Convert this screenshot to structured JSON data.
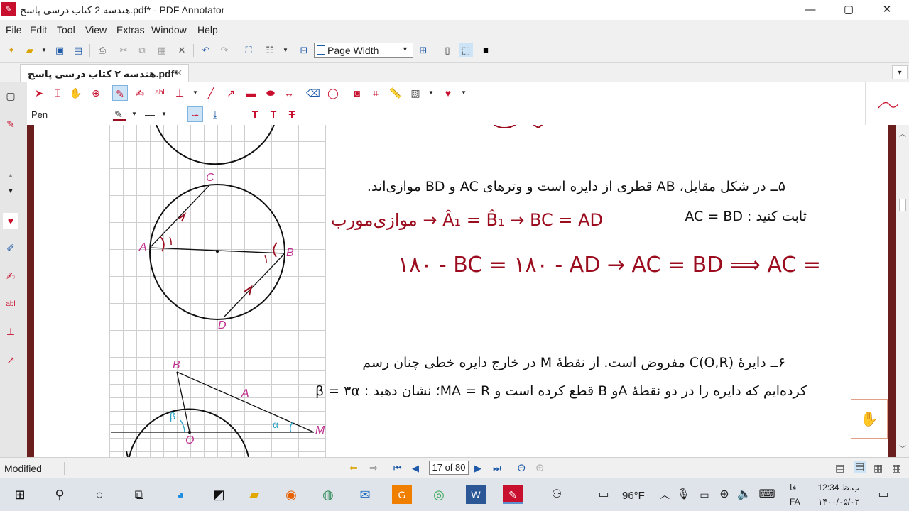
{
  "window": {
    "title": "هندسه 2 کتاب درسی پاسخ.pdf* - PDF Annotator",
    "minimize": "—",
    "maximize": "▢",
    "close": "✕"
  },
  "menu": [
    "File",
    "Edit",
    "Tool",
    "View",
    "Extras",
    "Window",
    "Help"
  ],
  "toolbar": {
    "zoom_value": "Page Width"
  },
  "tab": {
    "label": "هندسه ۲ کتاب درسی پاسخ.pdf*",
    "close": "✕"
  },
  "annotation_toolbar": {
    "tool_name": "Pen"
  },
  "document": {
    "q5_line1": "۵ــ در شکل مقابل، AB قطری از دایره است و وترهای AC و BD موازی‌اند.",
    "q5_line2": "ثابت کنید : AC = BD",
    "q6_line1": "۶ــ دایرهٔ (C(O,R مفروض است. از نقطهٔ M در خارج دایره خطی چنان رسم",
    "q6_line2": "کرده‌ایم که دایره را در دو نقطهٔ Aو B قطع کرده است و MA = R؛ نشان دهید : β = ۳α",
    "fig1_labels": {
      "c": "C",
      "a": "A",
      "b": "B",
      "d": "D",
      "angle_a": "۱",
      "angle_b": "۱"
    },
    "fig2_labels": {
      "b": "B",
      "a": "A",
      "o": "O",
      "m": "M",
      "beta": "β",
      "alpha": "α"
    },
    "hand_line1": "موازی‌مورب → Â₁ = B̂₁ → BC = AD",
    "hand_line2": "۱۸۰ - BC = ۱۸۰ - AD → AC = BD ⟹ AC ="
  },
  "status": {
    "modified": "Modified",
    "page_indicator": "17 of 80"
  },
  "taskbar": {
    "weather": "96°F",
    "lang": "فا",
    "lang2": "FA",
    "time": "12:34 ب.ظ",
    "date": "۱۴۰۰/۰۵/۰۲"
  },
  "colors": {
    "accent": "#c8102e",
    "ink": "#9b0d1e",
    "label_pink": "#c0308e"
  }
}
